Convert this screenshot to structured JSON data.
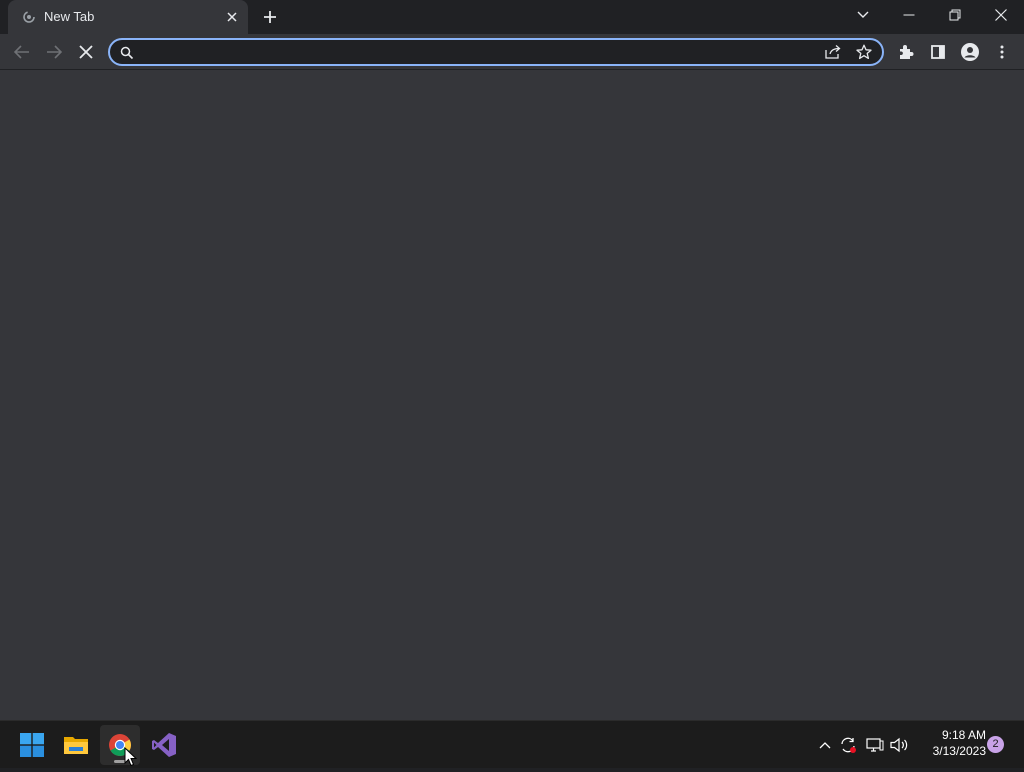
{
  "browser": {
    "tab": {
      "title": "New Tab"
    },
    "omnibox": {
      "value": "",
      "placeholder": ""
    },
    "colors": {
      "accent": "#8ab4f8",
      "background": "#35363a",
      "titlebar": "#202124"
    }
  },
  "toolbar": {
    "back_icon": "arrow-left-icon",
    "forward_icon": "arrow-right-icon",
    "stop_icon": "close-icon"
  },
  "taskbar": {
    "apps": [
      "start",
      "file-explorer",
      "chrome",
      "visual-studio"
    ],
    "clock": {
      "time": "9:18 AM",
      "date": "3/13/2023"
    },
    "notifications": "2"
  }
}
